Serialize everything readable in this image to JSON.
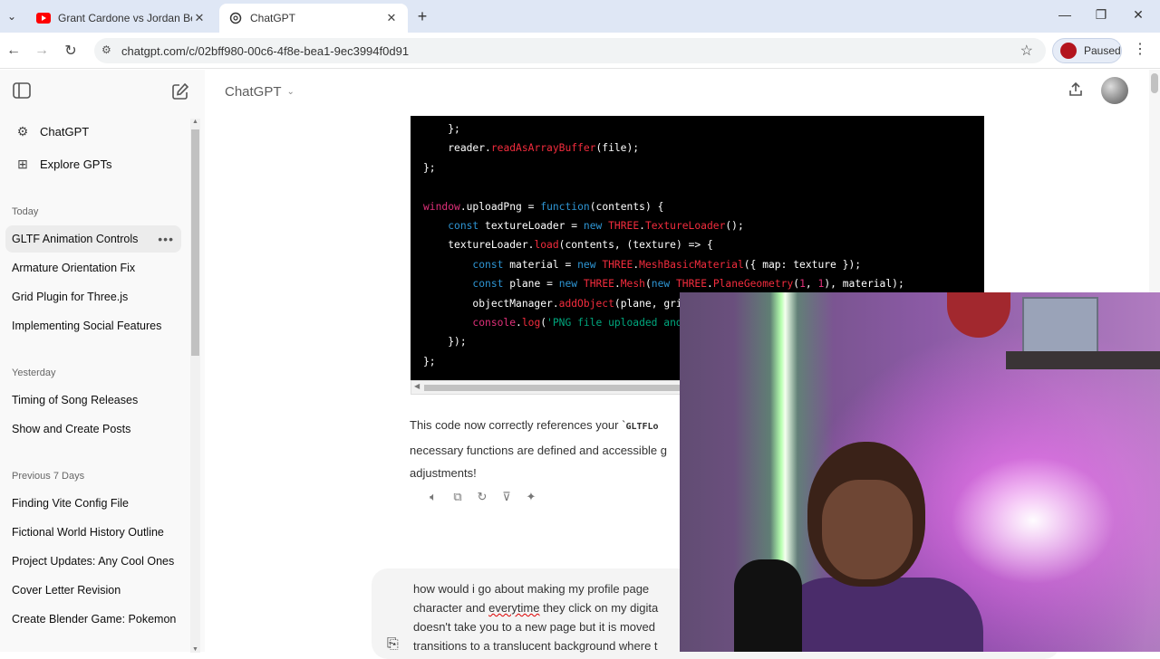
{
  "browser": {
    "tabs": [
      {
        "title": "Grant Cardone vs Jordan Belfort",
        "icon": "youtube-icon",
        "active": false
      },
      {
        "title": "ChatGPT",
        "icon": "chatgpt-icon",
        "active": true
      }
    ],
    "url": "chatgpt.com/c/02bff980-00c6-4f8e-bea1-9ec3994f0d91",
    "profile_label": "Paused",
    "colors": {
      "tabstrip": "#dfe7f5",
      "youtube": "#ff0000"
    }
  },
  "sidebar": {
    "nav": [
      {
        "label": "ChatGPT",
        "icon": "chatgpt-icon"
      },
      {
        "label": "Explore GPTs",
        "icon": "grid-icon"
      }
    ],
    "sections": [
      {
        "heading": "Today",
        "items": [
          "GLTF Animation Controls",
          "Armature Orientation Fix",
          "Grid Plugin for Three.js",
          "Implementing Social Features"
        ]
      },
      {
        "heading": "Yesterday",
        "items": [
          "Timing of Song Releases",
          "Show and Create Posts"
        ]
      },
      {
        "heading": "Previous 7 Days",
        "items": [
          "Finding Vite Config File",
          "Fictional World History Outline",
          "Project Updates: Any Cool Ones",
          "Cover Letter Revision",
          "Create Blender Game: Pokemon"
        ]
      }
    ],
    "more_label": "•••"
  },
  "main": {
    "model_title": "ChatGPT",
    "code_lines": [
      "    };",
      "    reader.readAsArrayBuffer(file);",
      "};",
      "",
      "window.uploadPng = function(contents) {",
      "    const textureLoader = new THREE.TextureLoader();",
      "    textureLoader.load(contents, (texture) => {",
      "        const material = new THREE.MeshBasicMaterial({ map: texture });",
      "        const plane = new THREE.Mesh(new THREE.PlaneGeometry(1, 1), material);",
      "        objectManager.addObject(plane, gri",
      "        console.log('PNG file uploaded and",
      "    });",
      "};"
    ],
    "reply_text_1": "This code now correctly references your `",
    "reply_code": "GLTFLo",
    "reply_text_2": "necessary functions are defined and accessible g",
    "reply_text_3": "adjustments!",
    "user_message_lines": [
      "how would i go about making my profile page",
      "character and ",
      "everytime",
      " they click on my digita",
      "doesn't take you to a new page but it is moved",
      "transitions to a translucent background where t"
    ]
  }
}
